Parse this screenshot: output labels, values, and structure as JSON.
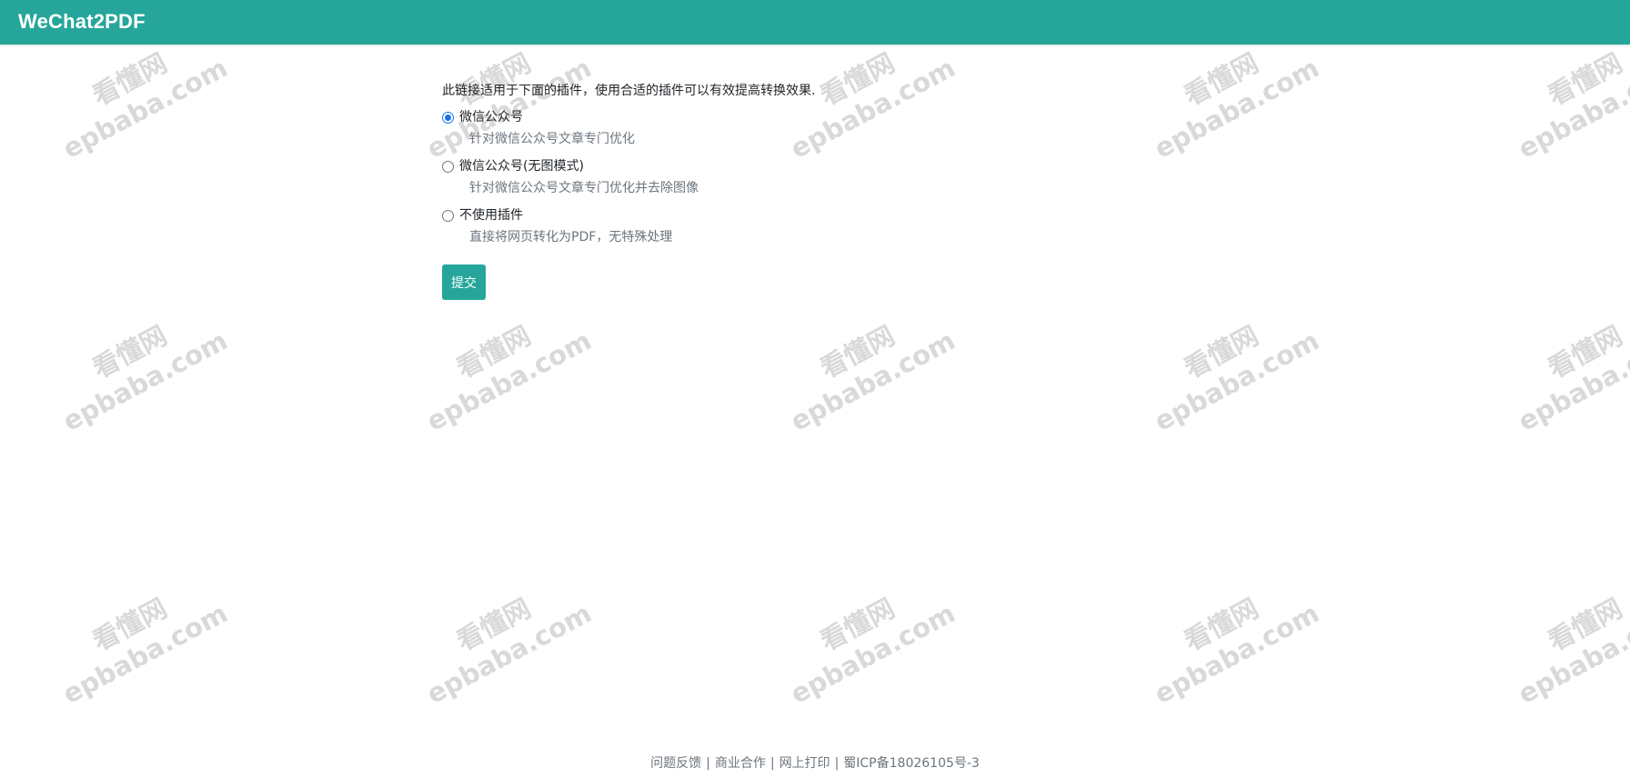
{
  "header": {
    "brand": "WeChat2PDF",
    "color": "#26a69a"
  },
  "watermark": {
    "line1": "看懂网",
    "line2": "epbaba.com"
  },
  "form": {
    "intro": "此链接适用于下面的插件，使用合适的插件可以有效提高转换效果.",
    "selected_index": 0,
    "options": [
      {
        "label": "微信公众号",
        "desc": "针对微信公众号文章专门优化"
      },
      {
        "label": "微信公众号(无图模式)",
        "desc": "针对微信公众号文章专门优化并去除图像"
      },
      {
        "label": "不使用插件",
        "desc": "直接将网页转化为PDF，无特殊处理"
      }
    ],
    "submit_label": "提交"
  },
  "footer": {
    "links": [
      "问题反馈",
      "商业合作",
      "网上打印",
      "蜀ICP备18026105号-3"
    ],
    "separator": "|"
  }
}
